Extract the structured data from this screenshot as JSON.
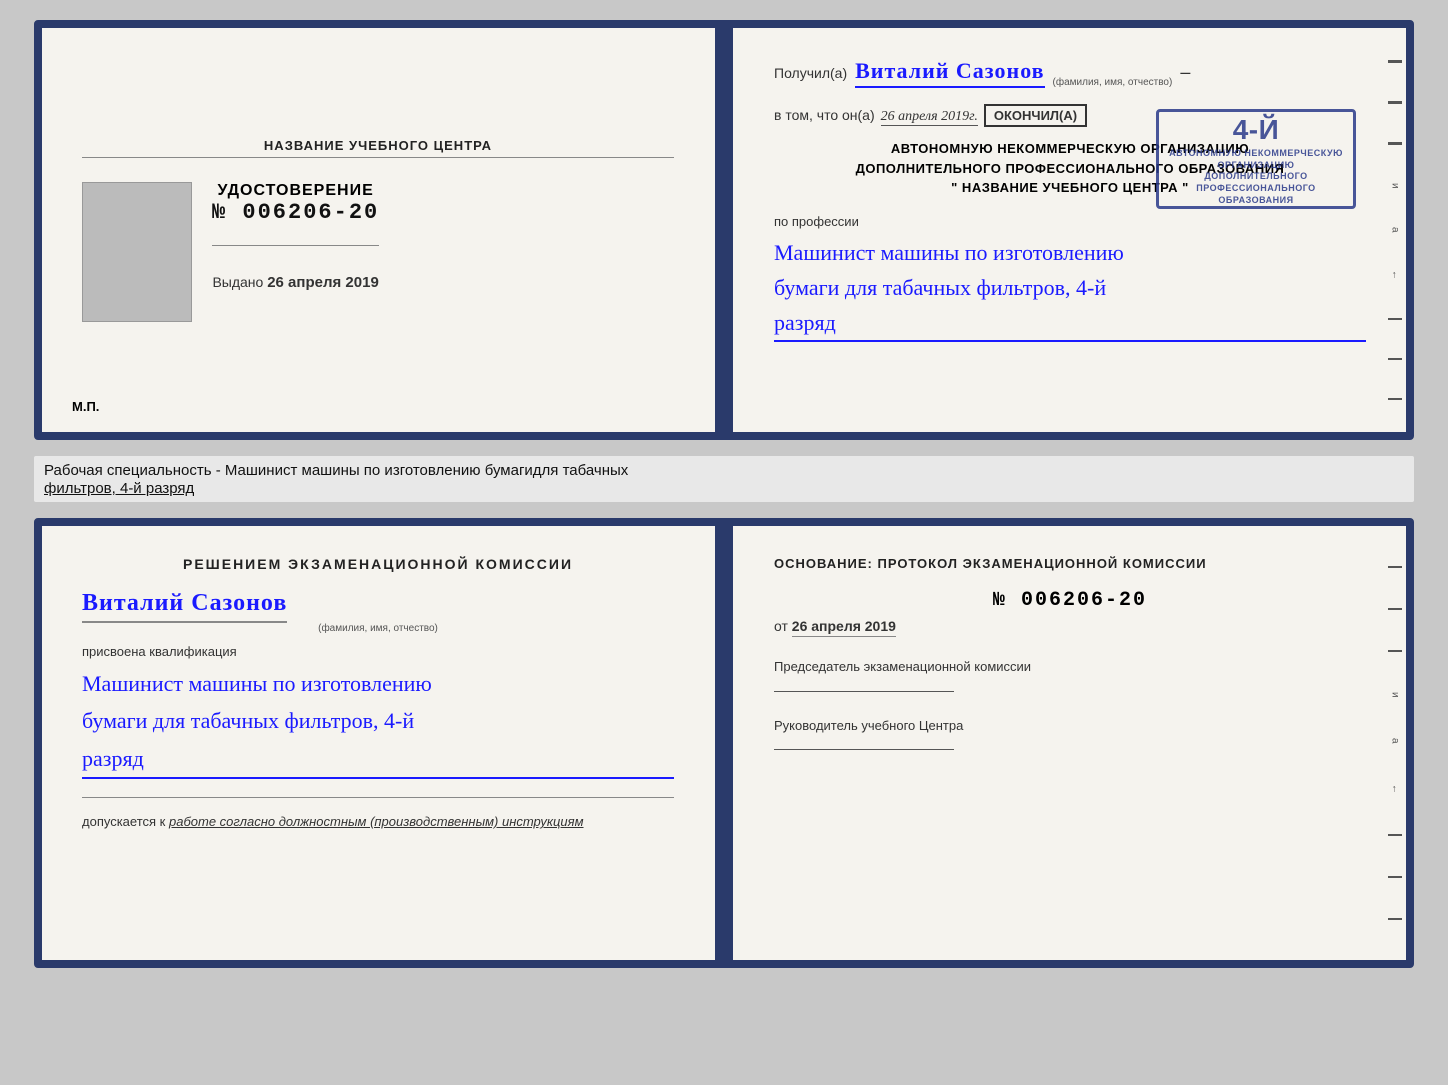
{
  "document_top": {
    "left": {
      "training_center_label": "НАЗВАНИЕ УЧЕБНОГО ЦЕНТРА",
      "udostoverenie_title": "УДОСТОВЕРЕНИЕ",
      "cert_number": "№ 006206-20",
      "issued_prefix": "Выдано",
      "issued_date": "26 апреля 2019",
      "mp_label": "М.П."
    },
    "right": {
      "recipient_prefix": "Получил(а)",
      "recipient_name": "Виталий Сазонов",
      "recipient_sub": "(фамилия, имя, отчество)",
      "dash": "–",
      "vtom_prefix": "в том, что он(а)",
      "vtom_date": "26 апреля 2019г.",
      "okончил_label": "окончил(а)",
      "org_line1": "АВТОНОМНУЮ НЕКОММЕРЧЕСКУЮ ОРГАНИЗАЦИЮ",
      "org_line2": "ДОПОЛНИТЕЛЬНОГО ПРОФЕССИОНАЛЬНОГО ОБРАЗОВАНИЯ",
      "org_line3": "\" НАЗВАНИЕ УЧЕБНОГО ЦЕНТРА \"",
      "po_professii": "по профессии",
      "profession_line1": "Машинист машины по изготовлению",
      "profession_line2": "бумаги для табачных фильтров, 4-й",
      "profession_line3": "разряд",
      "stamp_number": "4-й",
      "stamp_text": "АВТОНОМНУЮ НЕКОММЕРЧЕСКУЮ ОРГАНИЗАЦИЮ ДОПОЛНИТЕЛЬНОГО ПРОФЕССИОНАЛЬНОГО ОБРАЗОВАНИЯ\n\" НАЗВАНИЕ УЧЕБНОГО ЦЕНТРА \""
    }
  },
  "middle_label": {
    "text_prefix": "Рабочая специальность - Машинист машины по изготовлению бумагидля табачных",
    "text_underline": "фильтров, 4-й разряд"
  },
  "document_bottom": {
    "left": {
      "resolution_title": "Решением экзаменационной комиссии",
      "person_name": "Виталий Сазонов",
      "fio_sub": "(фамилия, имя, отчество)",
      "prisvоена_label": "присвоена квалификация",
      "qualification_line1": "Машинист машины по изготовлению",
      "qualification_line2": "бумаги для табачных фильтров, 4-й",
      "qualification_line3": "разряд",
      "dopuskaetsya_prefix": "допускается к",
      "dopuskaetsya_text": "работе согласно должностным (производственным) инструкциям"
    },
    "right": {
      "osnovaniye_label": "Основание: протокол экзаменационной комиссии",
      "cert_number": "№ 006206-20",
      "ot_prefix": "от",
      "ot_date": "26 апреля 2019",
      "predsedatel_label": "Председатель экзаменационной комиссии",
      "rukovoditel_label": "Руководитель учебного Центра"
    }
  }
}
